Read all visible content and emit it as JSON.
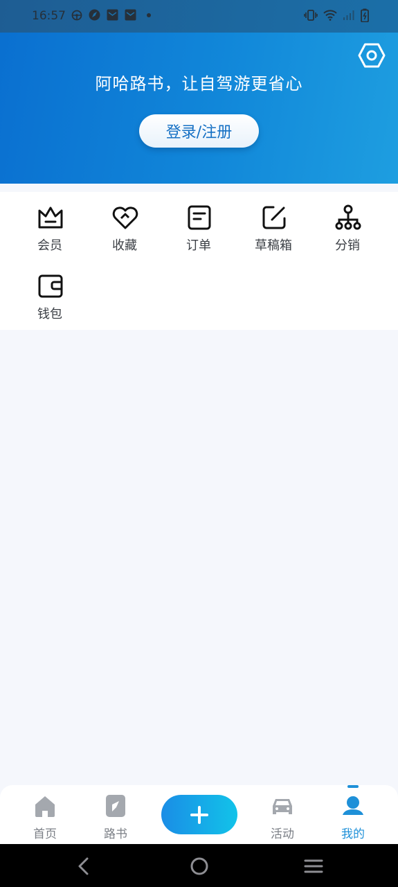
{
  "status_bar": {
    "time": "16:57",
    "left_icons": [
      "steering-wheel-icon",
      "compass-icon",
      "mail-icon",
      "mail-icon",
      "dot-icon"
    ],
    "right_icons": [
      "vibrate-icon",
      "wifi-icon",
      "signal-icon",
      "battery-icon"
    ]
  },
  "header": {
    "slogan": "阿哈路书，让自驾游更省心",
    "login_button": "登录/注册",
    "settings_icon": "settings-icon"
  },
  "menu": {
    "items": [
      {
        "label": "会员",
        "icon": "crown-icon"
      },
      {
        "label": "收藏",
        "icon": "heart-icon"
      },
      {
        "label": "订单",
        "icon": "order-icon"
      },
      {
        "label": "草稿箱",
        "icon": "edit-icon"
      },
      {
        "label": "分销",
        "icon": "hierarchy-icon"
      },
      {
        "label": "钱包",
        "icon": "wallet-icon"
      }
    ]
  },
  "tabbar": {
    "items": [
      {
        "label": "首页",
        "icon": "home-icon",
        "active": false
      },
      {
        "label": "路书",
        "icon": "roadbook-icon",
        "active": false
      },
      {
        "label": "",
        "icon": "plus-icon",
        "active": false
      },
      {
        "label": "活动",
        "icon": "car-icon",
        "active": false
      },
      {
        "label": "我的",
        "icon": "user-icon",
        "active": true
      }
    ]
  },
  "colors": {
    "brand": "#1187d9",
    "active_tab": "#1e90d8",
    "inactive_tab": "#7b7f86",
    "fab_start": "#1a8de6",
    "fab_end": "#12c3e9"
  }
}
